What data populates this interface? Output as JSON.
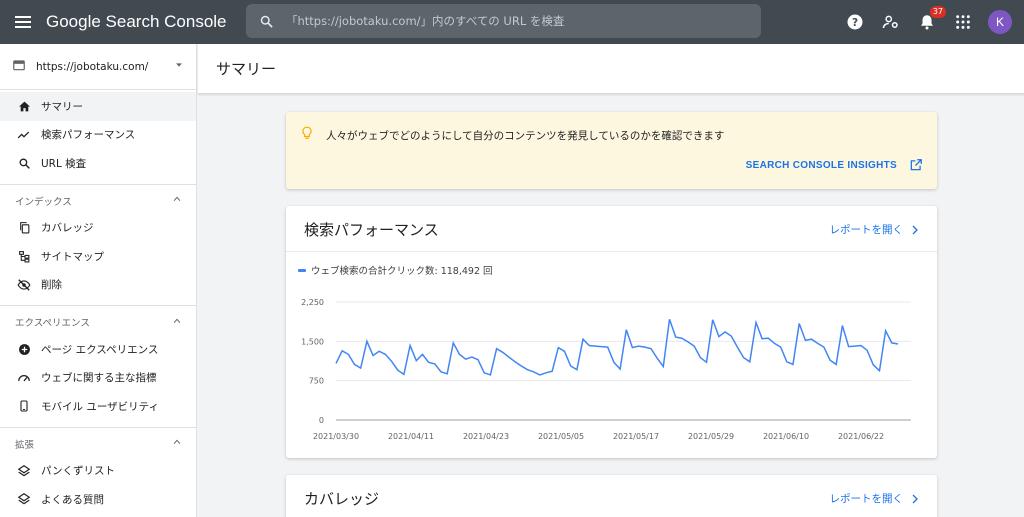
{
  "topbar": {
    "app_name": "Google Search Console",
    "search_placeholder": "「https://jobotaku.com/」内のすべての URL を検査",
    "notification_count": "37",
    "avatar_initial": "K",
    "icons": [
      "menu-icon",
      "search-icon",
      "help-icon",
      "manage-users-icon",
      "bell-icon",
      "apps-grid-icon"
    ]
  },
  "sidebar": {
    "property": "https://jobotaku.com/",
    "items": [
      {
        "label": "サマリー",
        "icon": "home-icon"
      },
      {
        "label": "検索パフォーマンス",
        "icon": "trending-icon"
      },
      {
        "label": "URL 検査",
        "icon": "search-icon"
      }
    ],
    "sections": [
      {
        "title": "インデックス",
        "items": [
          {
            "label": "カバレッジ",
            "icon": "copy-icon"
          },
          {
            "label": "サイトマップ",
            "icon": "sitemap-icon"
          },
          {
            "label": "削除",
            "icon": "eye-off-icon"
          }
        ]
      },
      {
        "title": "エクスペリエンス",
        "items": [
          {
            "label": "ページ エクスペリエンス",
            "icon": "plus-circle-icon"
          },
          {
            "label": "ウェブに関する主な指標",
            "icon": "speed-icon"
          },
          {
            "label": "モバイル ユーザビリティ",
            "icon": "phone-icon"
          }
        ]
      },
      {
        "title": "拡張",
        "items": [
          {
            "label": "パンくずリスト",
            "icon": "layers-icon"
          },
          {
            "label": "よくある質問",
            "icon": "layers-icon"
          }
        ]
      }
    ]
  },
  "main": {
    "page_title": "サマリー",
    "insight": {
      "text": "人々がウェブでどのようにして自分のコンテンツを発見しているのかを確認できます",
      "link": "SEARCH CONSOLE INSIGHTS"
    },
    "performance": {
      "title": "検索パフォーマンス",
      "link": "レポートを開く",
      "legend": "ウェブ検索の合計クリック数: 118,492 回"
    },
    "coverage": {
      "title": "カバレッジ",
      "link": "レポートを開く"
    }
  },
  "colors": {
    "topbar": "#414a51",
    "accent": "#1a73e8",
    "line": "#4285f4",
    "insight_bg": "#fef7e0"
  },
  "chart_data": {
    "type": "line",
    "series": [
      {
        "name": "ウェブ検索の合計クリック数: 118,492 回",
        "values": [
          1080,
          1320,
          1250,
          1060,
          990,
          1500,
          1230,
          1310,
          1250,
          1120,
          950,
          870,
          1420,
          1130,
          1250,
          1100,
          1070,
          920,
          880,
          1470,
          1250,
          1160,
          1200,
          1150,
          900,
          860,
          1360,
          1290,
          1200,
          1110,
          1030,
          960,
          920,
          860,
          900,
          930,
          1380,
          1310,
          1030,
          960,
          1540,
          1420,
          1410,
          1400,
          1390,
          1100,
          970,
          1720,
          1380,
          1410,
          1390,
          1360,
          1180,
          1020,
          1920,
          1580,
          1560,
          1490,
          1410,
          1190,
          1100,
          1910,
          1590,
          1680,
          1600,
          1390,
          1190,
          1110,
          1860,
          1550,
          1560,
          1460,
          1390,
          1110,
          1060,
          1840,
          1520,
          1540,
          1460,
          1390,
          1140,
          1060,
          1800,
          1400,
          1410,
          1420,
          1330,
          1050,
          940,
          1700,
          1470,
          1450
        ]
      }
    ],
    "x_ticks": [
      "2021/03/30",
      "2021/04/11",
      "2021/04/23",
      "2021/05/05",
      "2021/05/17",
      "2021/05/29",
      "2021/06/10",
      "2021/06/22"
    ],
    "y_ticks": [
      "0",
      "750",
      "1,500",
      "2,250"
    ],
    "ylim": [
      0,
      2250
    ],
    "grid": true
  }
}
